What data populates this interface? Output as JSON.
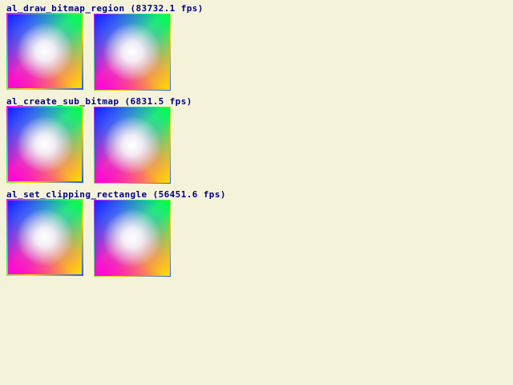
{
  "demos": [
    {
      "label": "al_draw_bitmap_region (83732.1 fps)"
    },
    {
      "label": "al_create_sub_bitmap (6831.5 fps)"
    },
    {
      "label": "al_set_clipping_rectangle (56451.6 fps)"
    }
  ]
}
